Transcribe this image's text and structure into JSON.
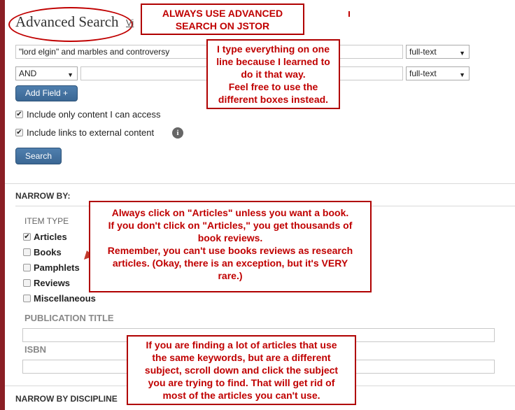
{
  "header": {
    "title": "Advanced Search",
    "view_link": "Vi"
  },
  "notes": {
    "always_use": [
      "ALWAYS USE ADVANCED",
      "SEARCH ON JSTOR"
    ],
    "one_line": [
      "I type everything on one",
      "line because I learned to",
      "do it that way.",
      "Feel free to use the",
      "different boxes instead."
    ],
    "articles": [
      "Always click on \"Articles\" unless you  want  a book.",
      "If you don't click on \"Articles,\"  you get thousands of",
      "book reviews.",
      "Remember, you can't use books reviews as research",
      "articles.  (Okay, there is an exception, but it's VERY",
      "rare.)"
    ],
    "keywords": [
      "If you are finding a lot of articles that use",
      "the same keywords, but are a different",
      "subject, scroll down and click the subject",
      "you are trying to find.   That will get rid of",
      "most of the articles you can't use."
    ]
  },
  "search": {
    "row1_value": "\"lord elgin\" and marbles and controversy",
    "row1_field": "full-text",
    "row2_operator": "AND",
    "row2_value": "",
    "row2_field": "full-text",
    "add_field_label": "Add Field +",
    "include_access_label": "Include only content I can access",
    "include_external_label": "Include links to external content",
    "info_icon_glyph": "i",
    "search_label": "Search"
  },
  "narrow": {
    "heading": "NARROW BY:",
    "item_type_heading": "ITEM TYPE",
    "item_types": [
      {
        "label": "Articles",
        "checked": true
      },
      {
        "label": "Books",
        "checked": false
      },
      {
        "label": "Pamphlets",
        "checked": false
      },
      {
        "label": "Reviews",
        "checked": false
      },
      {
        "label": "Miscellaneous",
        "checked": false
      }
    ],
    "publication_title_heading": "PUBLICATION TITLE",
    "isbn_heading": "ISBN",
    "discipline_heading": "NARROW BY DISCIPLINE"
  },
  "colors": {
    "accent_red": "#c00000",
    "left_bar": "#8a1f25",
    "button_blue": "#3b6794"
  },
  "icons": {
    "checked": "✔",
    "caret": "▼"
  }
}
